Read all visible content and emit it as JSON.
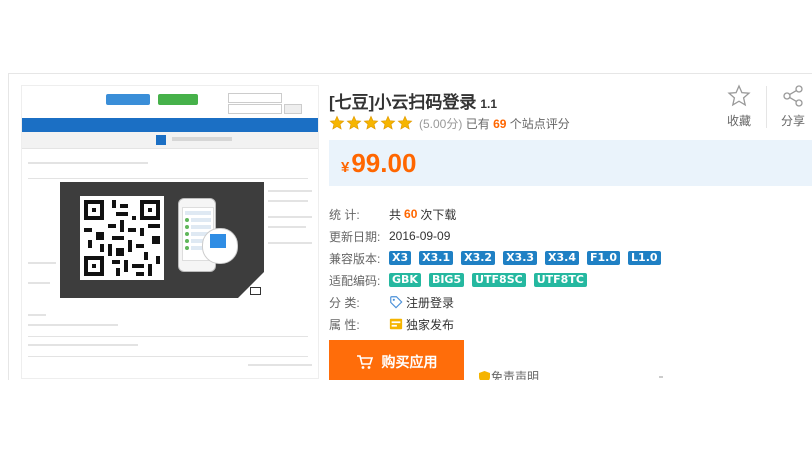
{
  "product": {
    "title": "[七豆]小云扫码登录",
    "version": "1.1",
    "rating": {
      "stars": 5,
      "score": "(5.00分)",
      "prefix": "已有",
      "count": "69",
      "suffix": "个站点评分"
    },
    "price": {
      "currency": "¥",
      "amount": "99.00"
    }
  },
  "actions": {
    "favorite_label": "收藏",
    "share_label": "分享"
  },
  "details": {
    "downloads": {
      "label": "统    计:",
      "prefix": "共",
      "count": "60",
      "suffix": "次下载"
    },
    "updated": {
      "label": "更新日期:",
      "value": "2016-09-09"
    },
    "compat": {
      "label": "兼容版本:",
      "tags": [
        "X3",
        "X3.1",
        "X3.2",
        "X3.3",
        "X3.4",
        "F1.0",
        "L1.0"
      ]
    },
    "encoding": {
      "label": "适配编码:",
      "tags": [
        "GBK",
        "BIG5",
        "UTF8SC",
        "UTF8TC"
      ]
    },
    "category": {
      "label": "分    类:",
      "value": "注册登录",
      "icon": "tag-icon"
    },
    "attribute": {
      "label": "属    性:",
      "value": "独家发布",
      "icon": "exclusive-badge-icon"
    }
  },
  "buy": {
    "label": "购买应用",
    "icon": "cart-icon"
  },
  "disclaimer": {
    "label": "免责声明",
    "icon": "shield-icon"
  },
  "colors": {
    "accent": "#ff6600",
    "star": "#f6b500",
    "tag_blue": "#1f80c4",
    "tag_green": "#25b8a0",
    "price_bg": "#eaf3fb",
    "buy_bg": "#ff6d0a"
  }
}
